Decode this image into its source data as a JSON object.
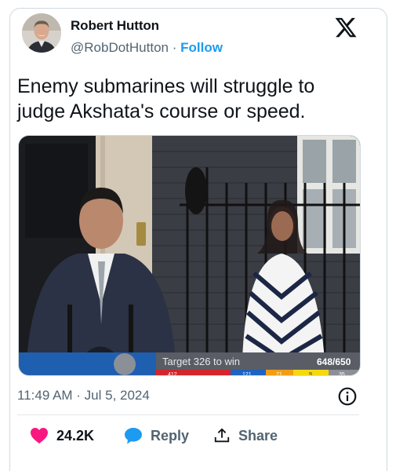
{
  "author": {
    "name": "Robert Hutton",
    "handle": "@RobDotHutton",
    "separator": "·",
    "follow_label": "Follow"
  },
  "tweet": {
    "text": "Enemy submarines will struggle to judge Akshata's course or speed."
  },
  "media": {
    "overlay_target": "Target 326 to win",
    "overlay_count": "648/650",
    "overlay_strip": [
      "412",
      "121",
      "71",
      "9",
      "35"
    ]
  },
  "meta": {
    "timestamp": "11:49 AM · Jul 5, 2024"
  },
  "actions": {
    "likes": "24.2K",
    "reply_label": "Reply",
    "share_label": "Share"
  },
  "colors": {
    "accent": "#1d9bf0",
    "like": "#f91880",
    "text": "#0f1419",
    "muted": "#536471"
  },
  "icons": [
    "x-logo-icon",
    "info-icon",
    "heart-icon",
    "reply-bubble-icon",
    "share-icon"
  ]
}
